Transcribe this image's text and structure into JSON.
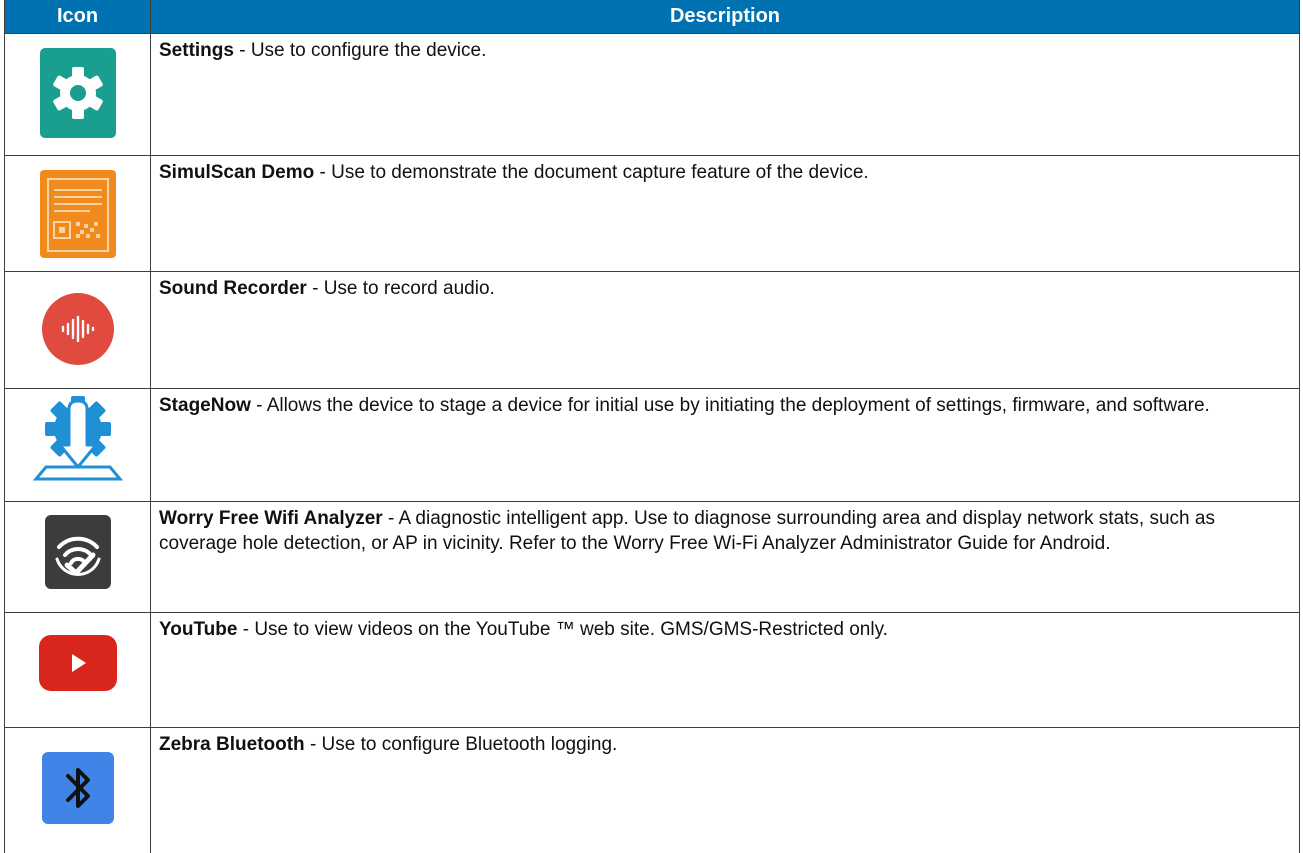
{
  "header": {
    "icon_col": "Icon",
    "desc_col": "Description"
  },
  "rows": [
    {
      "icon": "settings-gear-icon",
      "name": "Settings",
      "text": " - Use to configure the device."
    },
    {
      "icon": "simulscan-demo-icon",
      "name": "SimulScan Demo",
      "text": " - Use to demonstrate the document capture feature of the device."
    },
    {
      "icon": "sound-recorder-icon",
      "name": "Sound Recorder",
      "text": " - Use to record audio."
    },
    {
      "icon": "stagenow-icon",
      "name": "StageNow",
      "text": " - Allows the device to stage a device for initial use by initiating the deployment of settings, firmware, and software."
    },
    {
      "icon": "worry-free-wifi-analyzer-icon",
      "name": "Worry Free Wifi Analyzer",
      "text": " - A diagnostic intelligent app. Use to diagnose surrounding area and display network stats, such as coverage hole detection, or AP in vicinity. Refer to the Worry Free Wi-Fi Analyzer Administrator Guide for Android."
    },
    {
      "icon": "youtube-icon",
      "name": "YouTube",
      "text": " - Use to view videos on the YouTube ™ web site. GMS/GMS-Restricted only."
    },
    {
      "icon": "zebra-bluetooth-icon",
      "name": "Zebra Bluetooth",
      "text": " - Use to configure Bluetooth logging."
    }
  ],
  "colors": {
    "header_bg": "#0072b1",
    "header_text": "#ffffff",
    "settings": "#1a9e8f",
    "simulscan": "#f08a1c",
    "sound_recorder": "#e04a3f",
    "stagenow": "#1f8fd6",
    "wifi_analyzer": "#3c3c3c",
    "youtube": "#d9261c",
    "bluetooth": "#3f84e6"
  }
}
